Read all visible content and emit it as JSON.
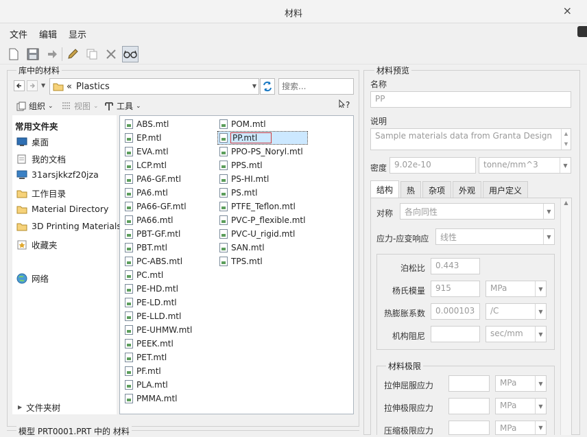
{
  "window": {
    "title": "材料",
    "close_glyph": "×"
  },
  "menu": [
    "文件",
    "编辑",
    "显示"
  ],
  "left_panel": {
    "legend": "库中的材料",
    "path_prefix": "«",
    "path": "Plastics",
    "search_placeholder": "搜索...",
    "org_label": "组织",
    "view_label": "视图",
    "tools_label": "工具",
    "help_glyph": "?",
    "common_folders_label": "常用文件夹",
    "sidebar": [
      "桌面",
      "我的文档",
      "31arsjkkzf20jza",
      "工作目录",
      "Material Directory",
      "3D Printing Materials",
      "收藏夹"
    ],
    "network": "网络",
    "folder_tree": "文件夹树",
    "files_col1": [
      "ABS.mtl",
      "EP.mtl",
      "EVA.mtl",
      "LCP.mtl",
      "PA6-GF.mtl",
      "PA6.mtl",
      "PA66-GF.mtl",
      "PA66.mtl",
      "PBT-GF.mtl",
      "PBT.mtl",
      "PC-ABS.mtl",
      "PC.mtl",
      "PE-HD.mtl",
      "PE-LD.mtl",
      "PE-LLD.mtl",
      "PE-UHMW.mtl",
      "PEEK.mtl",
      "PET.mtl",
      "PF.mtl",
      "PLA.mtl",
      "PMMA.mtl"
    ],
    "files_col2": [
      "POM.mtl",
      "PP.mtl",
      "PPO-PS_Noryl.mtl",
      "PPS.mtl",
      "PS-HI.mtl",
      "PS.mtl",
      "PTFE_Teflon.mtl",
      "PVC-P_flexible.mtl",
      "PVC-U_rigid.mtl",
      "SAN.mtl",
      "TPS.mtl"
    ],
    "selected_file": "PP.mtl",
    "bottom_legend": "模型 PRT0001.PRT 中的 材料"
  },
  "preview": {
    "legend": "材料预览",
    "name_label": "名称",
    "name_value": "PP",
    "desc_label": "说明",
    "desc_value": "Sample materials data from Granta Design",
    "density_label": "密度",
    "density_value": "9.02e-10",
    "density_unit": "tonne/mm^3",
    "tabs": [
      "结构",
      "热",
      "杂项",
      "外观",
      "用户定义"
    ],
    "symmetry_label": "对称",
    "symmetry_value": "各向同性",
    "stress_label": "应力-应变响应",
    "stress_value": "线性",
    "poisson_label": "泊松比",
    "poisson_value": "0.443",
    "young_label": "杨氏模量",
    "young_value": "915",
    "young_unit": "MPa",
    "thermal_label": "热膨胀系数",
    "thermal_value": "0.000103",
    "thermal_unit": "/C",
    "damping_label": "机构阻尼",
    "damping_unit": "sec/mm",
    "limits_legend": "材料极限",
    "tensile_yield_label": "拉伸屈服应力",
    "tensile_yield_unit": "MPa",
    "tensile_ult_label": "拉伸极限应力",
    "tensile_ult_unit": "MPa",
    "comp_ult_label": "压缩极限应力",
    "comp_ult_unit": "MPa"
  }
}
